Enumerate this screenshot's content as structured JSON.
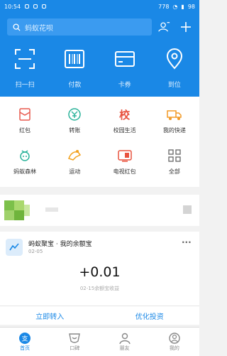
{
  "status": {
    "time": "10:54",
    "right": "778",
    "battery": "98"
  },
  "search": {
    "placeholder": "蚂蚁花呗"
  },
  "quick": [
    {
      "label": "扫一扫",
      "icon": "scan-icon"
    },
    {
      "label": "付款",
      "icon": "barcode-icon"
    },
    {
      "label": "卡券",
      "icon": "card-icon"
    },
    {
      "label": "到位",
      "icon": "location-icon"
    }
  ],
  "grid": [
    {
      "label": "红包",
      "icon": "red-envelope-icon",
      "color": "#e85a4f"
    },
    {
      "label": "转账",
      "icon": "transfer-icon",
      "color": "#2bb39a"
    },
    {
      "label": "校园生活",
      "icon": "campus-icon",
      "color": "#e8533f"
    },
    {
      "label": "我的快递",
      "icon": "delivery-truck-icon",
      "color": "#f29a27"
    },
    {
      "label": "蚂蚁森林",
      "icon": "forest-icon",
      "color": "#2bb39a"
    },
    {
      "label": "运动",
      "icon": "sport-icon",
      "color": "#f2a21f"
    },
    {
      "label": "电视红包",
      "icon": "tv-red-envelope-icon",
      "color": "#e8533f"
    },
    {
      "label": "全部",
      "icon": "grid-icon",
      "color": "#666666"
    }
  ],
  "card": {
    "title": "蚂蚁聚宝 · 我的余额宝",
    "date": "02-05",
    "amount": "+0.01",
    "sub": "02-15余额宝收益",
    "more": "···"
  },
  "actions": {
    "left": "立即转入",
    "right": "优化投资"
  },
  "tabs": [
    {
      "label": "首页",
      "icon": "home-icon",
      "active": true
    },
    {
      "label": "口碑",
      "icon": "koubei-icon",
      "active": false
    },
    {
      "label": "朋友",
      "icon": "friends-icon",
      "active": false
    },
    {
      "label": "我的",
      "icon": "profile-icon",
      "active": false
    }
  ],
  "colors": {
    "primary": "#1a88e6"
  }
}
